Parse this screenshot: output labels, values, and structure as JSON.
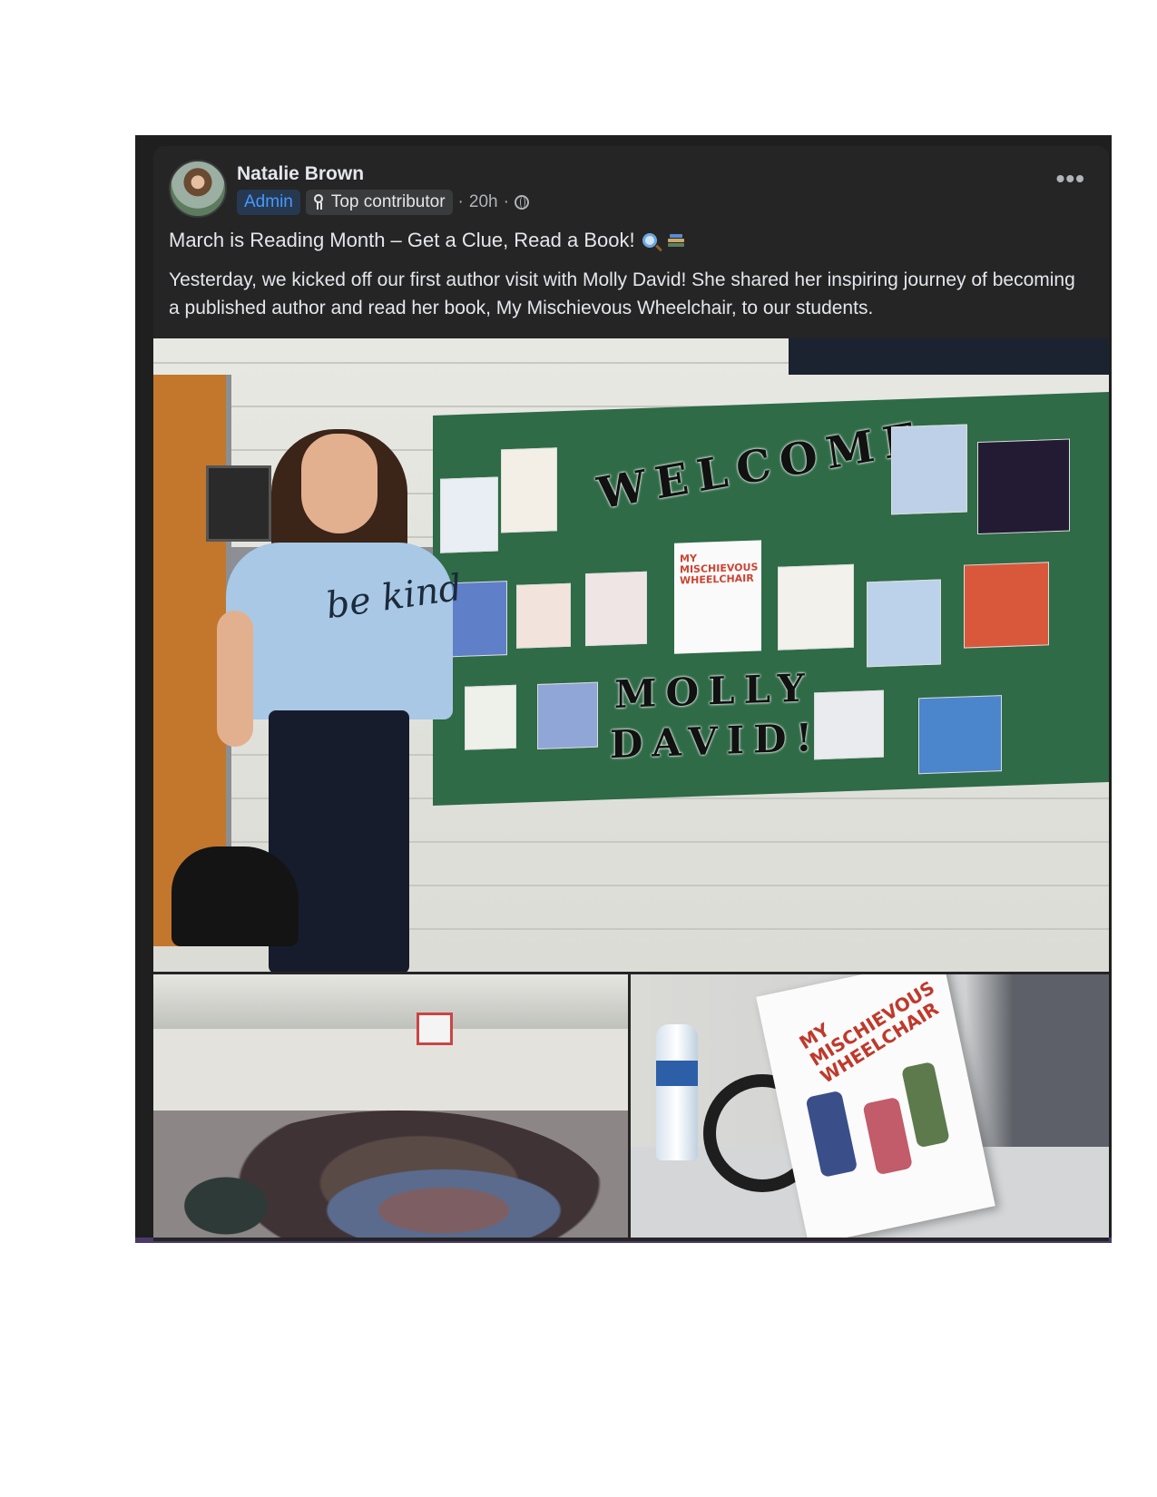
{
  "post": {
    "author": "Natalie Brown",
    "badges": {
      "admin": "Admin",
      "top_contributor": "Top contributor"
    },
    "separator": "·",
    "time": "20h",
    "privacy_icon": "globe-icon",
    "more_label": "•••",
    "headline": "March is Reading Month – Get a Clue, Read a Book!",
    "headline_icons": [
      "magnifying-glass-icon",
      "books-icon"
    ],
    "body": "Yesterday, we kicked off our first author visit with Molly David! She shared her inspiring journey of becoming a published author and read her book, My Mischievous Wheelchair, to our students."
  },
  "photos": {
    "main": {
      "board_welcome": "WELCOME",
      "board_molly": "MOLLY",
      "board_david": "DAVID!",
      "cover_title": "MY MISCHIEVOUS WHEELCHAIR",
      "shirt_text": "be kind"
    },
    "book": {
      "cover_title": "MY MISCHIEVOUS WHEELCHAIR"
    }
  },
  "colors": {
    "background": "#1f1f20",
    "card": "#252526",
    "text": "#e4e6eb",
    "secondary_text": "#b0b3b8",
    "admin_badge_text": "#4599ff",
    "admin_badge_bg": "#263951",
    "bottom_bar": "#4a3a6b"
  }
}
